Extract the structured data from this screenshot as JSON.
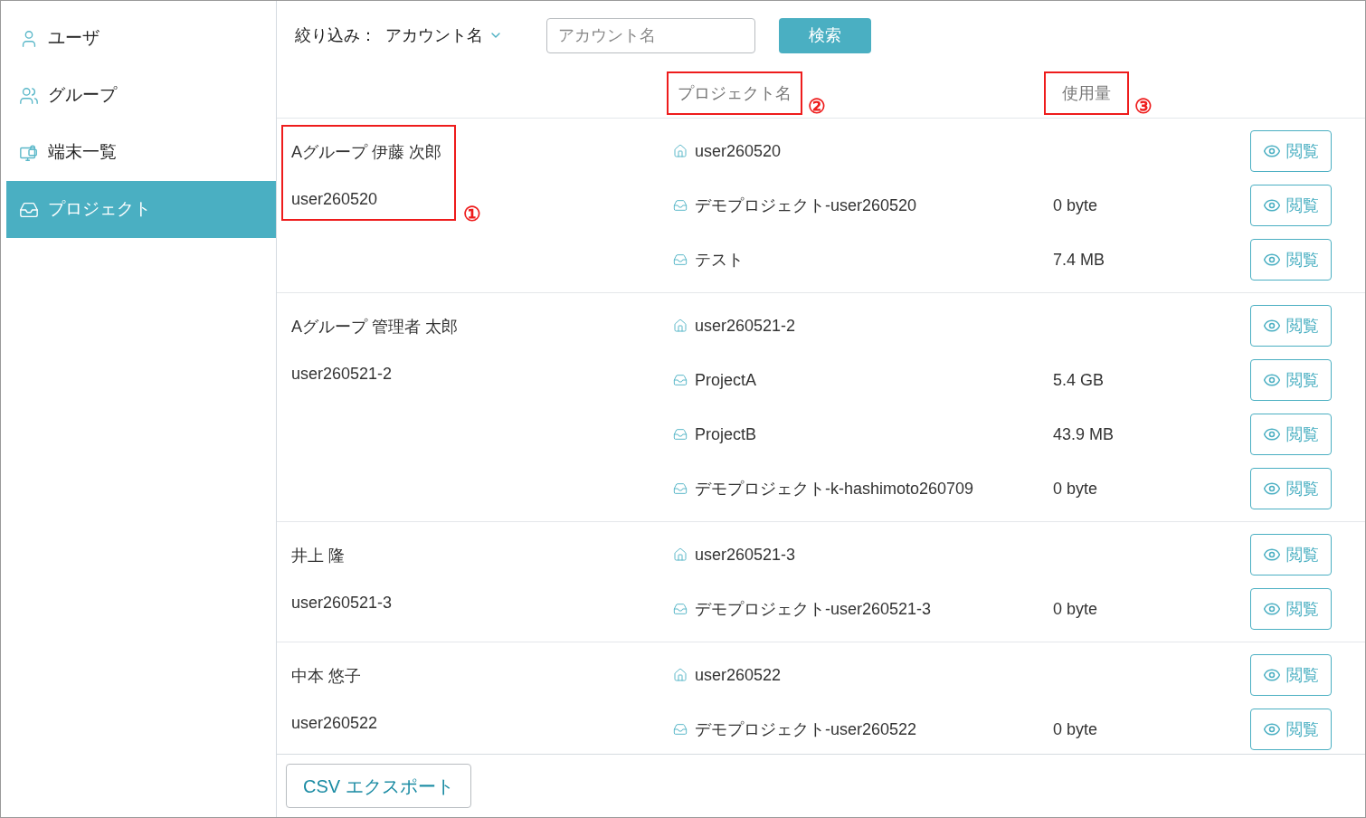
{
  "sidebar": {
    "items": [
      {
        "label": "ユーザ",
        "kind": "user",
        "selected": false
      },
      {
        "label": "グループ",
        "kind": "group",
        "selected": false
      },
      {
        "label": "端末一覧",
        "kind": "device",
        "selected": false
      },
      {
        "label": "プロジェクト",
        "kind": "project",
        "selected": true
      }
    ]
  },
  "filter": {
    "label": "絞り込み：",
    "value": "アカウント名"
  },
  "search": {
    "placeholder": "アカウント名"
  },
  "search_button": "検索",
  "columns": [
    {
      "label": "プロジェクト名",
      "callout": "②"
    },
    {
      "label": "使用量",
      "callout": "③"
    }
  ],
  "groups": [
    {
      "account_name": "Aグループ 伊藤 次郎",
      "account_id": "user260520",
      "callout": "①",
      "projects": [
        {
          "kind": "home",
          "name": "user260520",
          "button": "閲覧"
        },
        {
          "kind": "project",
          "name": "デモプロジェクト-user260520",
          "usage": "0 byte",
          "button": "閲覧"
        },
        {
          "kind": "project",
          "name": "テスト",
          "usage": "7.4 MB",
          "button": "閲覧"
        }
      ]
    },
    {
      "account_name": "Aグループ 管理者 太郎",
      "account_id": "user260521-2",
      "projects": [
        {
          "kind": "home",
          "name": "user260521-2",
          "button": "閲覧"
        },
        {
          "kind": "project",
          "name": "ProjectA",
          "usage": "5.4 GB",
          "button": "閲覧"
        },
        {
          "kind": "project",
          "name": "ProjectB",
          "usage": "43.9 MB",
          "button": "閲覧"
        },
        {
          "kind": "project",
          "name": "デモプロジェクト-k-hashimoto260709",
          "usage": "0 byte",
          "button": "閲覧"
        }
      ]
    },
    {
      "account_name": "井上 隆",
      "account_id": "user260521-3",
      "projects": [
        {
          "kind": "home",
          "name": "user260521-3",
          "button": "閲覧"
        },
        {
          "kind": "project",
          "name": "デモプロジェクト-user260521-3",
          "usage": "0 byte",
          "button": "閲覧"
        }
      ]
    },
    {
      "account_name": "中本 悠子",
      "account_id": "user260522",
      "projects": [
        {
          "kind": "home",
          "name": "user260522",
          "button": "閲覧"
        },
        {
          "kind": "project",
          "name": "デモプロジェクト-user260522",
          "usage": "0 byte",
          "button": "閲覧"
        }
      ]
    }
  ],
  "export_button": "CSV エクスポート"
}
